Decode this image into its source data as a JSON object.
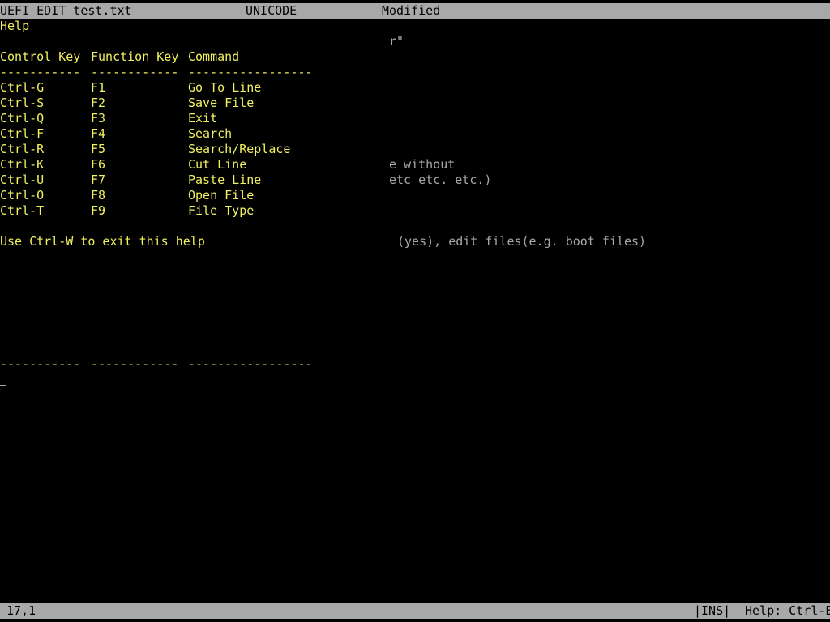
{
  "title_bar": {
    "file": "UEFI EDIT test.txt",
    "encoding": "UNICODE",
    "state": "Modified"
  },
  "help": {
    "title": "Help",
    "headers": [
      "Control Key",
      "Function Key",
      "Command"
    ],
    "separators": [
      "-----------",
      "------------",
      "-----------------"
    ],
    "rows": [
      {
        "ctrl": "Ctrl-G",
        "fkey": "F1",
        "command": "Go To Line"
      },
      {
        "ctrl": "Ctrl-S",
        "fkey": "F2",
        "command": "Save File"
      },
      {
        "ctrl": "Ctrl-Q",
        "fkey": "F3",
        "command": "Exit"
      },
      {
        "ctrl": "Ctrl-F",
        "fkey": "F4",
        "command": "Search"
      },
      {
        "ctrl": "Ctrl-R",
        "fkey": "F5",
        "command": "Search/Replace"
      },
      {
        "ctrl": "Ctrl-K",
        "fkey": "F6",
        "command": "Cut Line"
      },
      {
        "ctrl": "Ctrl-U",
        "fkey": "F7",
        "command": "Paste Line"
      },
      {
        "ctrl": "Ctrl-O",
        "fkey": "F8",
        "command": "Open File"
      },
      {
        "ctrl": "Ctrl-T",
        "fkey": "F9",
        "command": "File Type"
      }
    ],
    "exit_hint": "Use Ctrl-W to exit this help"
  },
  "background_text": {
    "line_1": "r\"",
    "line_2": "e without",
    "line_3": "etc etc. etc.)",
    "line_4": "(yes), edit files(e.g. boot files)"
  },
  "status_bar": {
    "position": "17,1",
    "mode": "|INS|",
    "help": "Help: Ctrl-E"
  },
  "colors": {
    "background": "#000000",
    "bar": "#a8a8a8",
    "help_text": "#f0f060",
    "file_text": "#a8a8a8"
  }
}
